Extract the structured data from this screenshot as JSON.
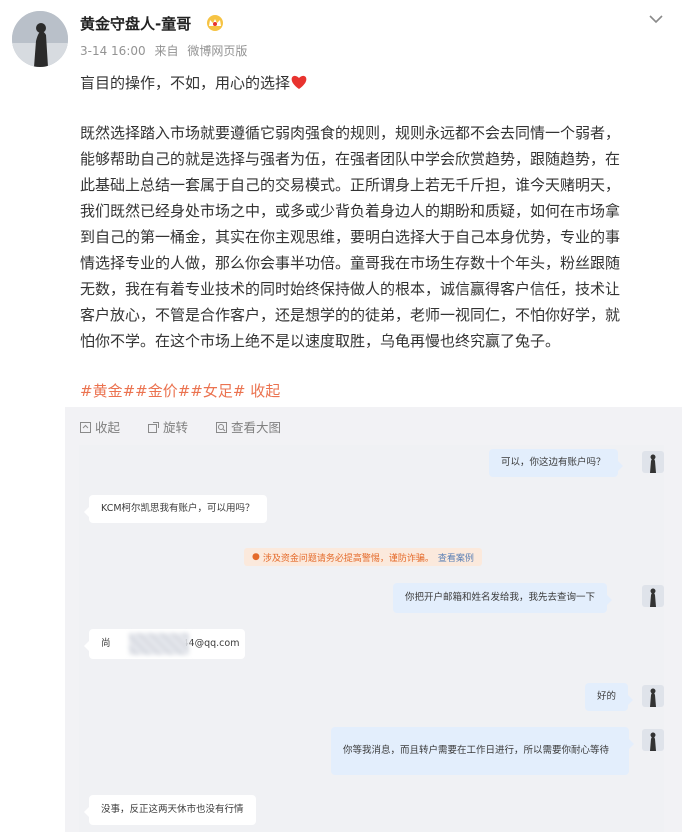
{
  "post": {
    "author_name": "黄金守盘人-童哥",
    "time": "3-14 16:00",
    "source_prefix": "来自",
    "source": "微博网页版",
    "first_line": "盲目的操作，不如，用心的选择",
    "body_lines": [
      "既然选择踏入市场就要遵循它弱肉强食的规则，规则永远都不会去同情一个弱者，",
      "能够帮助自己的就是选择与强者为伍，在强者团队中学会欣赏趋势，跟随趋势，在",
      "此基础上总结一套属于自己的交易模式。正所谓身上若无千斤担，谁今天赌明天，",
      "我们既然已经身处市场之中，或多或少背负着身边人的期盼和质疑，如何在市场拿",
      "到自己的第一桶金，其实在你主观思维，要明白选择大于自己本身优势，专业的事",
      "情选择专业的人做，那么你会事半功倍。童哥我在市场生存数十个年头，粉丝跟随",
      "无数，我在有着专业技术的同时始终保持做人的根本，诚信赢得客户信任，技术让",
      "客户放心，不管是合作客户，还是想学的的徒弟，老师一视同仁，不怕你好学，就",
      "怕你不学。在这个市场上绝不是以速度取胜，乌龟再慢也终究赢了兔子。"
    ],
    "tags": [
      "#黄金#",
      "#金价#",
      "#女足#"
    ],
    "collapse_link": "收起"
  },
  "image_toolbar": {
    "collapse": "收起",
    "rotate": "旋转",
    "view_large": "查看大图"
  },
  "chat": {
    "messages": [
      {
        "side": "right",
        "text": "可以，你这边有账户吗？"
      },
      {
        "side": "left",
        "text": "KCM柯尔凯思我有账户，可以用吗？"
      },
      {
        "side": "right",
        "text": "你把开户邮箱和姓名发给我，我先去查询一下"
      },
      {
        "side": "left",
        "text_prefix": "尚",
        "text_suffix": "44@qq.com"
      },
      {
        "side": "right",
        "text": "好的"
      },
      {
        "side": "right",
        "text": "你等我消息，而且转户需要在工作日进行，所以需要你耐心等待"
      },
      {
        "side": "left",
        "text": "没事，反正这两天休市也没有行情"
      }
    ],
    "warning": "涉及资金问题请务必提高警惕，谨防诈骗。",
    "warning_link": "查看案例"
  },
  "colors": {
    "tag": "#eb7350",
    "heart": "#e8332f",
    "right_bubble": "#e3eefc",
    "chat_bg": "#f0f1f4",
    "warn_text": "#e46a2a"
  },
  "icons": [
    "chevron-down-icon",
    "vip-crown-icon",
    "heart-icon",
    "collapse-icon",
    "rotate-icon",
    "zoom-icon"
  ]
}
